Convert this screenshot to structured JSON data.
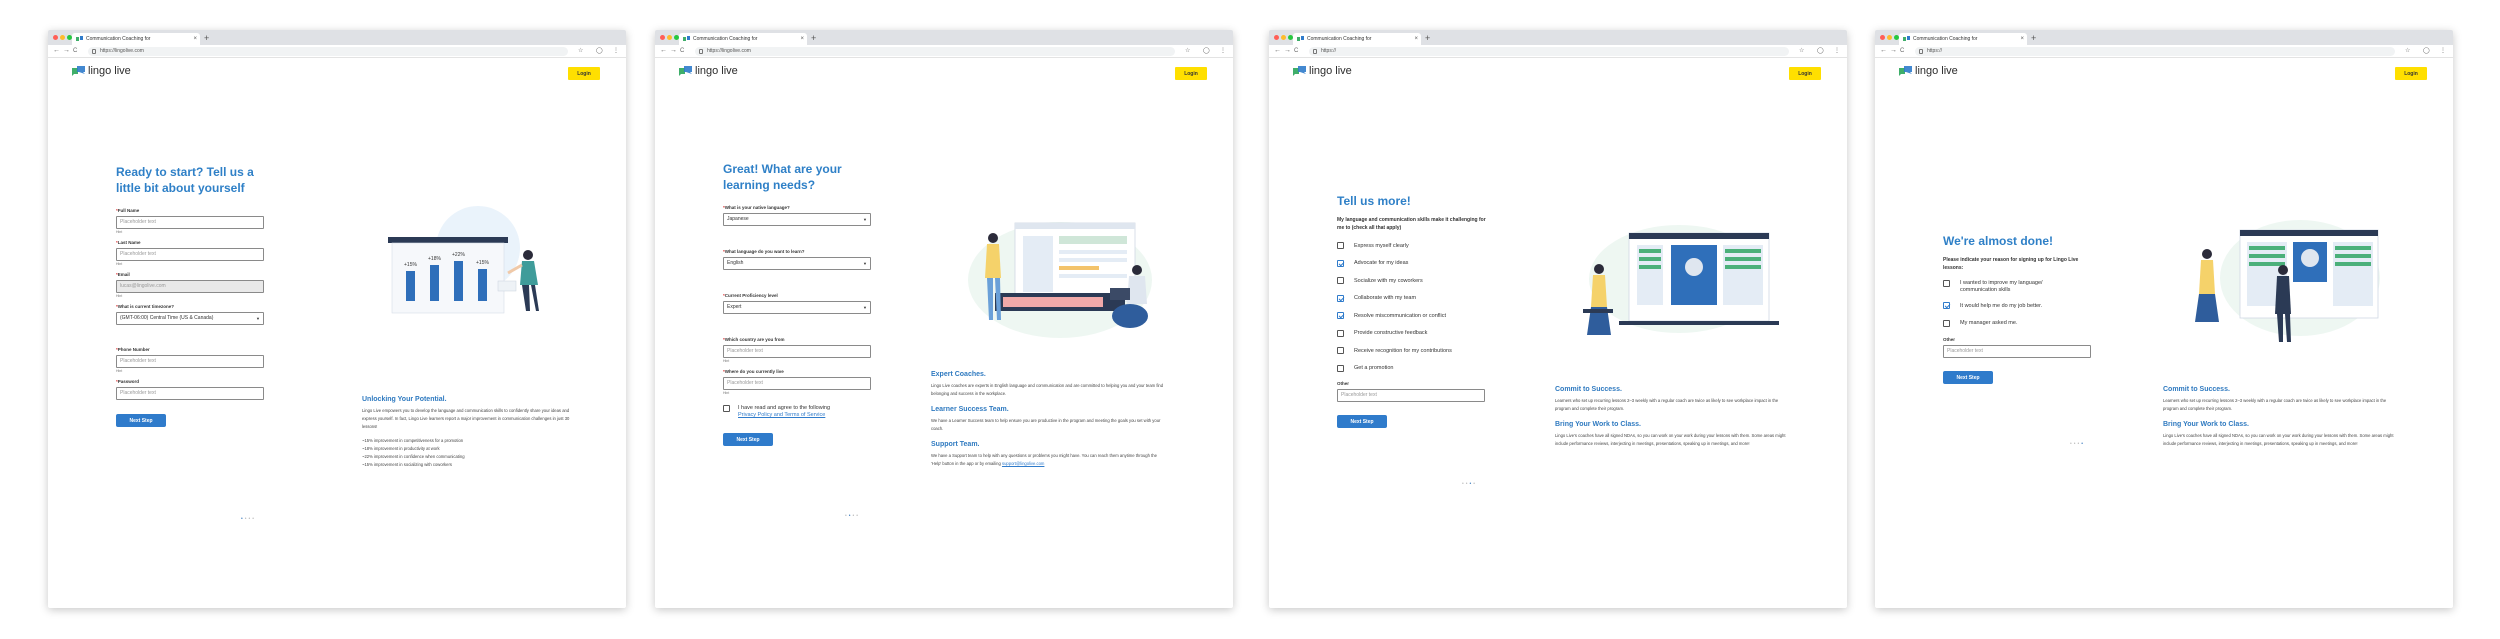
{
  "browser": {
    "tab_title": "Communication Coaching for",
    "tab_close": "×",
    "new_tab": "+",
    "nav_back": "←",
    "nav_forward": "→",
    "nav_reload": "C",
    "nav_home": "⌂",
    "star": "☆",
    "menu": "⋮",
    "url_1": "https://lingolive.com",
    "url_2": "https://lingolive.com",
    "url_3": "https://",
    "url_4": "https://"
  },
  "brand": {
    "logo_text": "lingo live",
    "login": "Login",
    "accent": "#2f7bcb",
    "cta": "#ffdf00"
  },
  "step1": {
    "title_line1": "Ready to start? Tell us a",
    "title_line2": "little bit about yourself",
    "fields": {
      "full_name_label": "Full Name",
      "full_name_placeholder": "Placeholder text",
      "last_name_label": "Last Name",
      "last_name_placeholder": "Placeholder text",
      "email_label": "Email",
      "email_placeholder": "lucas@lingolive.com",
      "timezone_label": "What is current timezone?",
      "timezone_value": "(GMT-06:00) Central Time (US & Canada)",
      "phone_label": "Phone Number",
      "phone_placeholder": "Placeholder text",
      "password_label": "Password",
      "password_placeholder": "Placeholder text",
      "hint": "Hint"
    },
    "next": "Next Step",
    "chart_labels": [
      "+15%",
      "+18%",
      "+22%",
      "+15%"
    ],
    "info_title": "Unlocking Your Potential.",
    "info_text": "Lingo Live empowers you to develop the language and communication skills to confidently share your ideas and express yourself. In fact, Lingo Live learners report a major improvement in communication challenges in just 30 lessons!",
    "stats": [
      "~15% improvement in competitiveness for a promotion",
      "~18% improvement in productivity at work",
      "~22% improvement in confidence when communicating",
      "~15% improvement in socializing with coworkers"
    ]
  },
  "step2": {
    "title_line1": "Great! What are your",
    "title_line2": "learning needs?",
    "native_label": "What is your native language?",
    "native_value": "Japanese",
    "learn_label": "What language do you want to learn?",
    "learn_value": "English",
    "level_label": "Current Proficiency level",
    "level_value": "Expert",
    "from_label": "Which country are you from",
    "from_placeholder": "Placeholder text",
    "live_label": "Where do you currently live",
    "live_placeholder": "Placeholder text",
    "hint": "Hint",
    "agree_text": "I have read and agree to the following",
    "agree_link": "Privacy Policy and Terms of Service",
    "next": "Next Step",
    "info": [
      {
        "title": "Expert Coaches.",
        "text": "Lingo Live coaches are experts in English language and communication and are committed to helping you and your team find belonging and success in the workplace."
      },
      {
        "title": "Learner Success Team.",
        "text": "We have a Learner Success team to help ensure you are productive in the program and meeting the goals you set with your coach."
      },
      {
        "title": "Support Team.",
        "text": "We have a Support team to help with any questions or problems you might have. You can reach them anytime through the 'Help' button in the app or by emailing",
        "link": "support@lingolive.com"
      }
    ]
  },
  "step3": {
    "title": "Tell us more!",
    "prompt": "My language and communication skills make it challenging for me to (check all that apply)",
    "options": [
      {
        "label": "Express myself clearly",
        "checked": false
      },
      {
        "label": "Advocate for my ideas",
        "checked": true
      },
      {
        "label": "Socialize with my coworkers",
        "checked": false
      },
      {
        "label": "Collaborate with my team",
        "checked": true
      },
      {
        "label": "Resolve miscommunication or conflict",
        "checked": true
      },
      {
        "label": "Provide constructive feedback",
        "checked": false
      },
      {
        "label": "Receive recognition for my contributions",
        "checked": false
      },
      {
        "label": "Get a promotion",
        "checked": false
      }
    ],
    "other_label": "Other",
    "other_placeholder": "Placeholder text",
    "next": "Next Step"
  },
  "step4": {
    "title": "We're almost done!",
    "prompt": "Please indicate your reason for signing up for Lingo Live lessons:",
    "options": [
      {
        "label": "I wanted to improve my language/ communication skills",
        "checked": false
      },
      {
        "label": "It would help me do my job better.",
        "checked": true
      },
      {
        "label": "My manager asked me.",
        "checked": false
      }
    ],
    "other_label": "Other",
    "other_placeholder": "Placeholder text",
    "next": "Next Step"
  },
  "commit_info": [
    {
      "title": "Commit to Success.",
      "text": "Learners who set up recurring lessons 2–3 weekly with a regular coach are twice as likely to see workplace impact in the program and complete their program."
    },
    {
      "title": "Bring Your Work to Class.",
      "text": "Lingo Live's coaches have all signed NDAs, so you can work on your work during your lessons with them. Some areas might include performance reviews, interjecting in meetings, presentations, speaking up in meetings, and more!"
    }
  ],
  "pager": "• • • •"
}
